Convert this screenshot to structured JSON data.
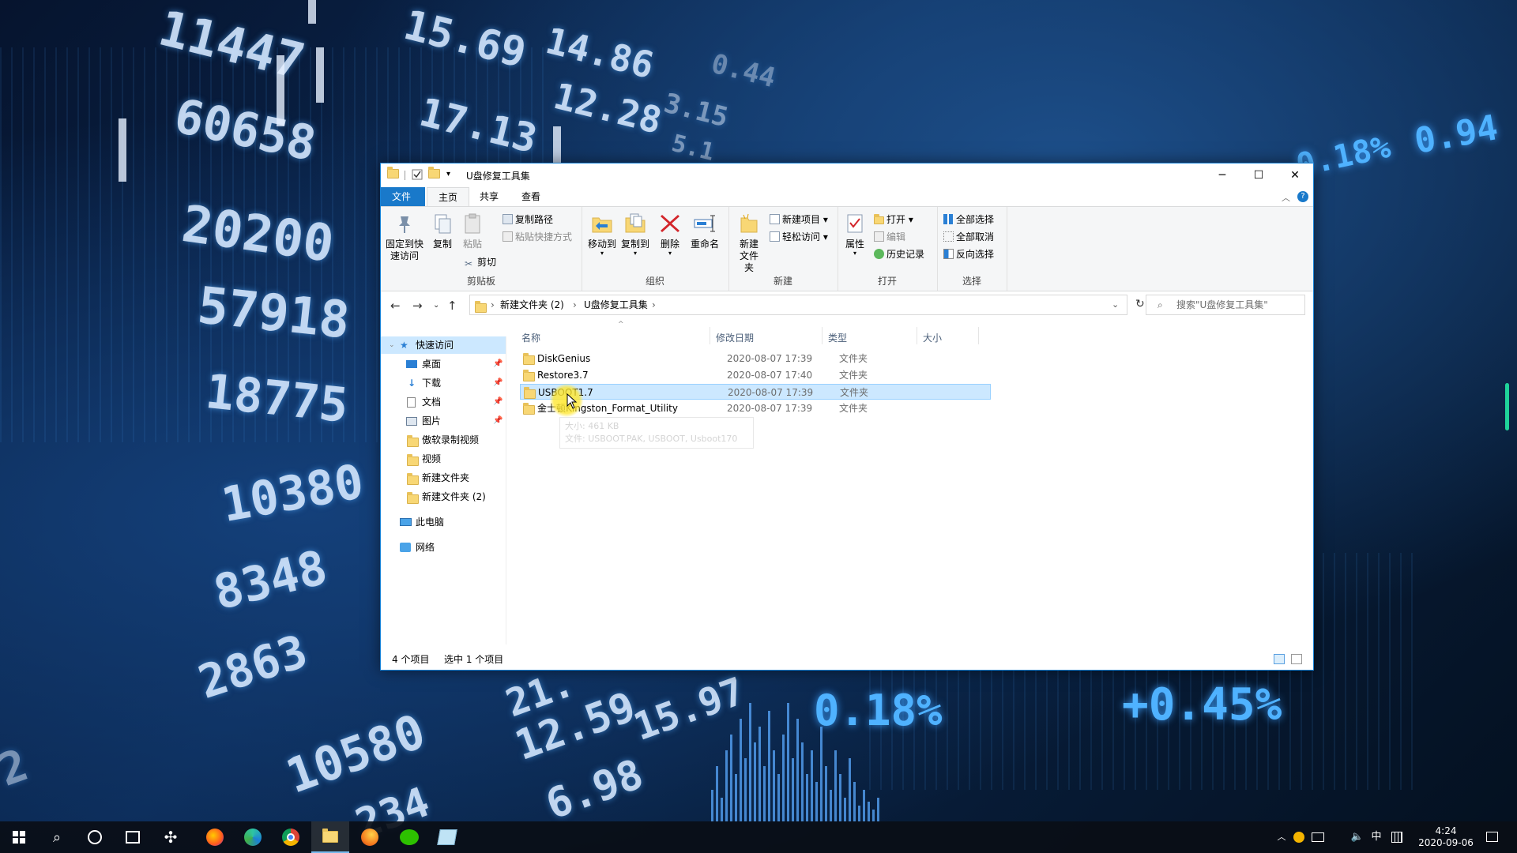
{
  "background_numbers": [
    "11447",
    "15.69",
    "14.86",
    "12.28",
    "60658",
    "17.13",
    "20200",
    "57918",
    "18775",
    "10380",
    "8348",
    "2863",
    "10580",
    "12.59",
    "15.97",
    "6.98",
    "234",
    "0.18%",
    "+0.45%",
    "0.94",
    "0.18%",
    "3.15",
    "5.1",
    "0.44",
    "21.",
    "2"
  ],
  "window": {
    "title": "U盘修复工具集",
    "controls": {
      "minimize": "─",
      "maximize": "☐",
      "close": "✕"
    }
  },
  "ribbon_tabs": [
    "文件",
    "主页",
    "共享",
    "查看"
  ],
  "ribbon": {
    "clipboard": {
      "pin_label": "固定到快速访问",
      "copy_label": "复制",
      "paste_label": "粘贴",
      "copy_path": "复制路径",
      "paste_shortcut": "粘贴快捷方式",
      "cut": "剪切",
      "group_label": "剪贴板"
    },
    "organize": {
      "move_to": "移动到",
      "copy_to": "复制到",
      "delete": "删除",
      "rename": "重命名",
      "group_label": "组织"
    },
    "new": {
      "new_folder": "新建文件夹",
      "new_item": "新建项目",
      "easy_access": "轻松访问",
      "group_label": "新建"
    },
    "open": {
      "properties": "属性",
      "open": "打开",
      "edit": "编辑",
      "history": "历史记录",
      "group_label": "打开"
    },
    "select": {
      "select_all": "全部选择",
      "select_none": "全部取消",
      "invert": "反向选择",
      "group_label": "选择"
    }
  },
  "address": {
    "crumb1": "新建文件夹 (2)",
    "crumb2": "U盘修复工具集",
    "search_placeholder": "搜索\"U盘修复工具集\""
  },
  "nav_pane": {
    "quick_access": "快速访问",
    "items": [
      "桌面",
      "下载",
      "文档",
      "图片",
      "傲软录制视频",
      "视频",
      "新建文件夹",
      "新建文件夹 (2)"
    ],
    "this_pc": "此电脑",
    "network": "网络"
  },
  "columns": {
    "name": "名称",
    "date": "修改日期",
    "type": "类型",
    "size": "大小"
  },
  "files": [
    {
      "name": "DiskGenius",
      "date": "2020-08-07 17:39",
      "type": "文件夹"
    },
    {
      "name": "Restore3.7",
      "date": "2020-08-07 17:40",
      "type": "文件夹"
    },
    {
      "name": "USBOOT1.7",
      "date": "2020-08-07 17:39",
      "type": "文件夹"
    },
    {
      "name": "金士顿Kingston_Format_Utility",
      "date": "2020-08-07 17:39",
      "type": "文件夹"
    }
  ],
  "tooltip": {
    "size": "大小: 461 KB",
    "files": "文件: USBOOT.PAK, USBOOT, Usboot170"
  },
  "status": {
    "count": "4 个项目",
    "selected": "选中 1 个项目"
  },
  "taskbar": {
    "time": "4:24",
    "date": "2020-09-06",
    "ime": "中"
  }
}
